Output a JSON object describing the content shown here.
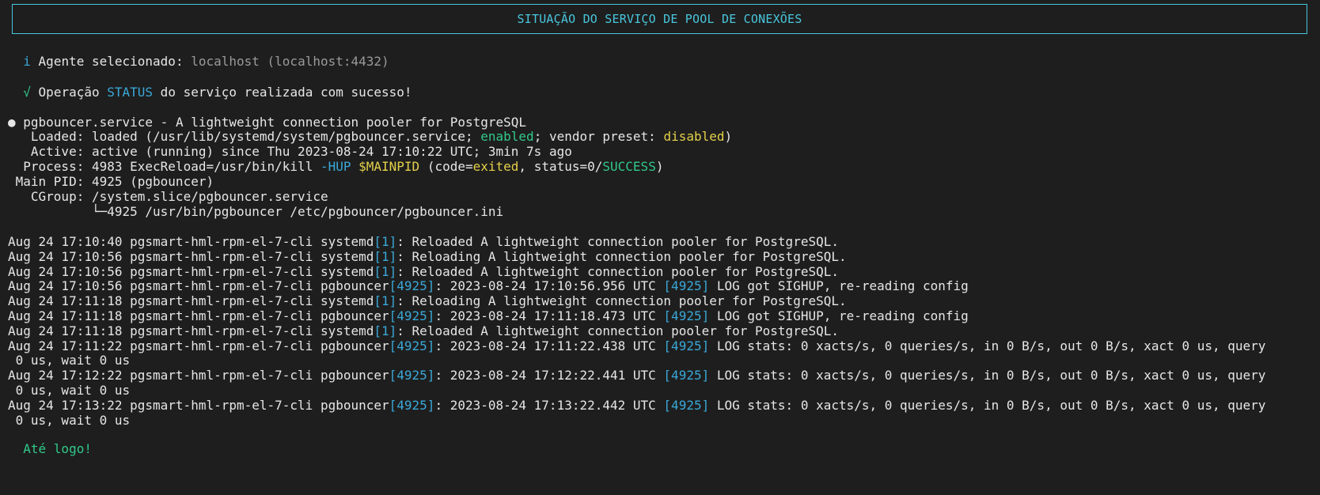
{
  "banner": {
    "title": "SITUAÇÃO DO SERVIÇO DE POOL DE CONEXÕES"
  },
  "agent": {
    "icon": "i",
    "label": "Agente selecionado: ",
    "value": "localhost (localhost:4432)"
  },
  "operation": {
    "icon": "√",
    "prefix": "Operação ",
    "keyword": "STATUS",
    "suffix": " do serviço realizada com sucesso!"
  },
  "status": {
    "bullet": "●",
    "header": "pgbouncer.service - A lightweight connection pooler for PostgreSQL",
    "loaded_label": "   Loaded: ",
    "loaded_pre": "loaded (/usr/lib/systemd/system/pgbouncer.service; ",
    "loaded_enabled": "enabled",
    "loaded_mid": "; vendor preset: ",
    "loaded_disabled": "disabled",
    "loaded_post": ")",
    "active_label": "   Active: ",
    "active_value": "active (running) since Thu 2023-08-24 17:10:22 UTC; 3min 7s ago",
    "process_label": "  Process: ",
    "process_pre": "4983 ExecReload=/usr/bin/kill ",
    "process_hup": "-HUP",
    "process_sp": " ",
    "process_mainpid": "$MAINPID",
    "process_mid": " (code=",
    "process_exited": "exited",
    "process_mid2": ", status=0/",
    "process_success": "SUCCESS",
    "process_post": ")",
    "mainpid_label": " Main PID: ",
    "mainpid_value": "4925 (pgbouncer)",
    "cgroup_label": "   CGroup: ",
    "cgroup_value": "/system.slice/pgbouncer.service",
    "cgroup_child": "           └─4925 /usr/bin/pgbouncer /etc/pgbouncer/pgbouncer.ini"
  },
  "log": [
    {
      "prefix": "Aug 24 17:10:40 pgsmart-hml-rpm-el-7-cli systemd",
      "pid": "[1]",
      "rest": ": Reloaded A lightweight connection pooler for PostgreSQL."
    },
    {
      "prefix": "Aug 24 17:10:56 pgsmart-hml-rpm-el-7-cli systemd",
      "pid": "[1]",
      "rest": ": Reloading A lightweight connection pooler for PostgreSQL."
    },
    {
      "prefix": "Aug 24 17:10:56 pgsmart-hml-rpm-el-7-cli systemd",
      "pid": "[1]",
      "rest": ": Reloaded A lightweight connection pooler for PostgreSQL."
    },
    {
      "prefix": "Aug 24 17:10:56 pgsmart-hml-rpm-el-7-cli pgbouncer",
      "pid": "[4925]",
      "mid": ": 2023-08-24 17:10:56.956 UTC ",
      "pid2": "[4925]",
      "rest": " LOG got SIGHUP, re-reading config"
    },
    {
      "prefix": "Aug 24 17:11:18 pgsmart-hml-rpm-el-7-cli systemd",
      "pid": "[1]",
      "rest": ": Reloading A lightweight connection pooler for PostgreSQL."
    },
    {
      "prefix": "Aug 24 17:11:18 pgsmart-hml-rpm-el-7-cli pgbouncer",
      "pid": "[4925]",
      "mid": ": 2023-08-24 17:11:18.473 UTC ",
      "pid2": "[4925]",
      "rest": " LOG got SIGHUP, re-reading config"
    },
    {
      "prefix": "Aug 24 17:11:18 pgsmart-hml-rpm-el-7-cli systemd",
      "pid": "[1]",
      "rest": ": Reloaded A lightweight connection pooler for PostgreSQL."
    },
    {
      "prefix": "Aug 24 17:11:22 pgsmart-hml-rpm-el-7-cli pgbouncer",
      "pid": "[4925]",
      "mid": ": 2023-08-24 17:11:22.438 UTC ",
      "pid2": "[4925]",
      "rest": " LOG stats: 0 xacts/s, 0 queries/s, in 0 B/s, out 0 B/s, xact 0 us, query",
      "wrap": " 0 us, wait 0 us"
    },
    {
      "prefix": "Aug 24 17:12:22 pgsmart-hml-rpm-el-7-cli pgbouncer",
      "pid": "[4925]",
      "mid": ": 2023-08-24 17:12:22.441 UTC ",
      "pid2": "[4925]",
      "rest": " LOG stats: 0 xacts/s, 0 queries/s, in 0 B/s, out 0 B/s, xact 0 us, query",
      "wrap": " 0 us, wait 0 us"
    },
    {
      "prefix": "Aug 24 17:13:22 pgsmart-hml-rpm-el-7-cli pgbouncer",
      "pid": "[4925]",
      "mid": ": 2023-08-24 17:13:22.442 UTC ",
      "pid2": "[4925]",
      "rest": " LOG stats: 0 xacts/s, 0 queries/s, in 0 B/s, out 0 B/s, xact 0 us, query",
      "wrap": " 0 us, wait 0 us"
    }
  ],
  "farewell": "Até logo!",
  "colors": {
    "background": "#1e1e1e",
    "accent_cyan": "#48c6dc",
    "success_green": "#30c98a",
    "warning_yellow": "#e3d04a",
    "pid_blue": "#3aa8d8"
  }
}
